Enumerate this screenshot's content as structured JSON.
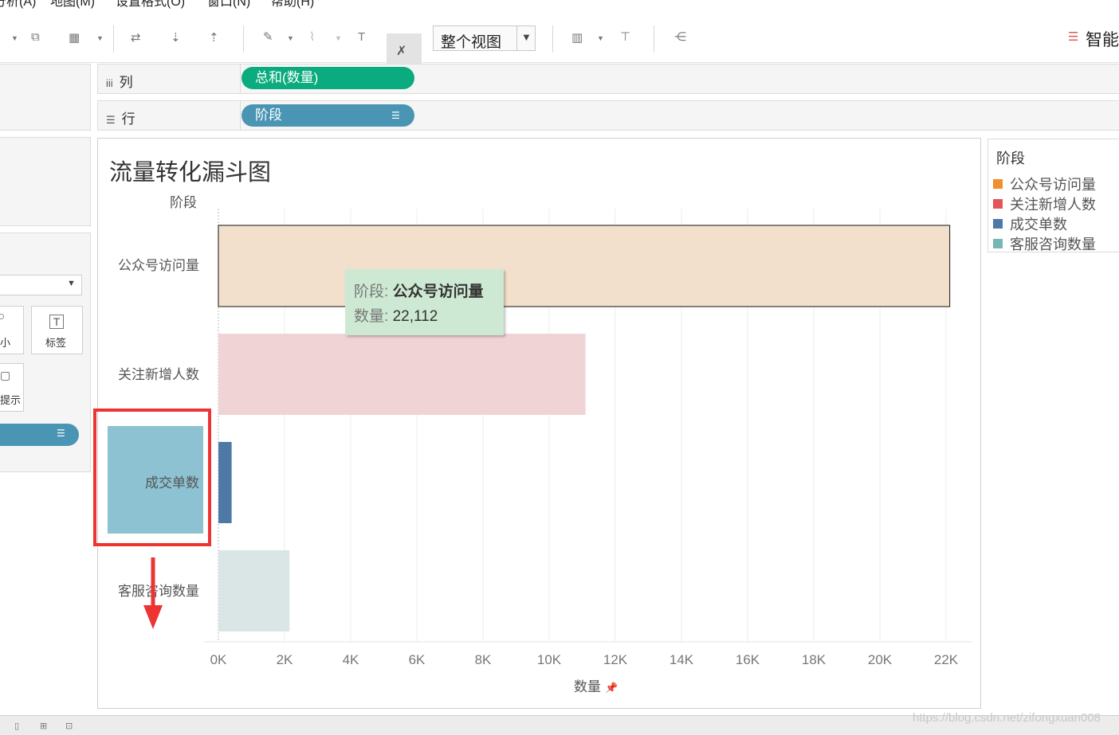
{
  "menu": [
    "分析(A)",
    "地图(M)",
    "设置格式(O)",
    "窗口(N)",
    "帮助(H)"
  ],
  "toolbar": {
    "fit_select_value": "整个视图",
    "smart_label": "智能"
  },
  "left_panel": {
    "marks_size_label": "小",
    "marks_label_label": "标签",
    "marks_tooltip_label": "提示"
  },
  "shelves": {
    "columns": {
      "label": "列",
      "pill": "总和(数量)",
      "pill_color": "#0aab7e"
    },
    "rows": {
      "label": "行",
      "pill": "阶段",
      "pill_color": "#4a95b4"
    }
  },
  "tooltip": {
    "stage_key": "阶段:",
    "stage_value": "公众号访问量",
    "qty_key": "数量:",
    "qty_value": "22,112"
  },
  "legend": {
    "title": "阶段",
    "items": [
      {
        "label": "公众号访问量",
        "color": "#f28e2b"
      },
      {
        "label": "关注新增人数",
        "color": "#e15759"
      },
      {
        "label": "成交单数",
        "color": "#4e79a7"
      },
      {
        "label": "客服咨询数量",
        "color": "#76b7b2"
      }
    ]
  },
  "footer": {
    "watermark": "https://blog.csdn.net/zifongxuan008"
  },
  "chart_data": {
    "type": "bar",
    "orientation": "horizontal",
    "title": "流量转化漏斗图",
    "row_header": "阶段",
    "categories": [
      "公众号访问量",
      "关注新增人数",
      "成交单数",
      "客服咨询数量"
    ],
    "values": [
      22112,
      11100,
      400,
      2150
    ],
    "colors": [
      "#f3e0cc",
      "#f0d4d5",
      "#4e79a7",
      "#d9e6e5"
    ],
    "xlabel": "数量",
    "xlim": [
      0,
      22000
    ],
    "x_ticks": [
      "0K",
      "2K",
      "4K",
      "6K",
      "8K",
      "10K",
      "12K",
      "14K",
      "16K",
      "18K",
      "20K",
      "22K"
    ],
    "grid": true
  }
}
